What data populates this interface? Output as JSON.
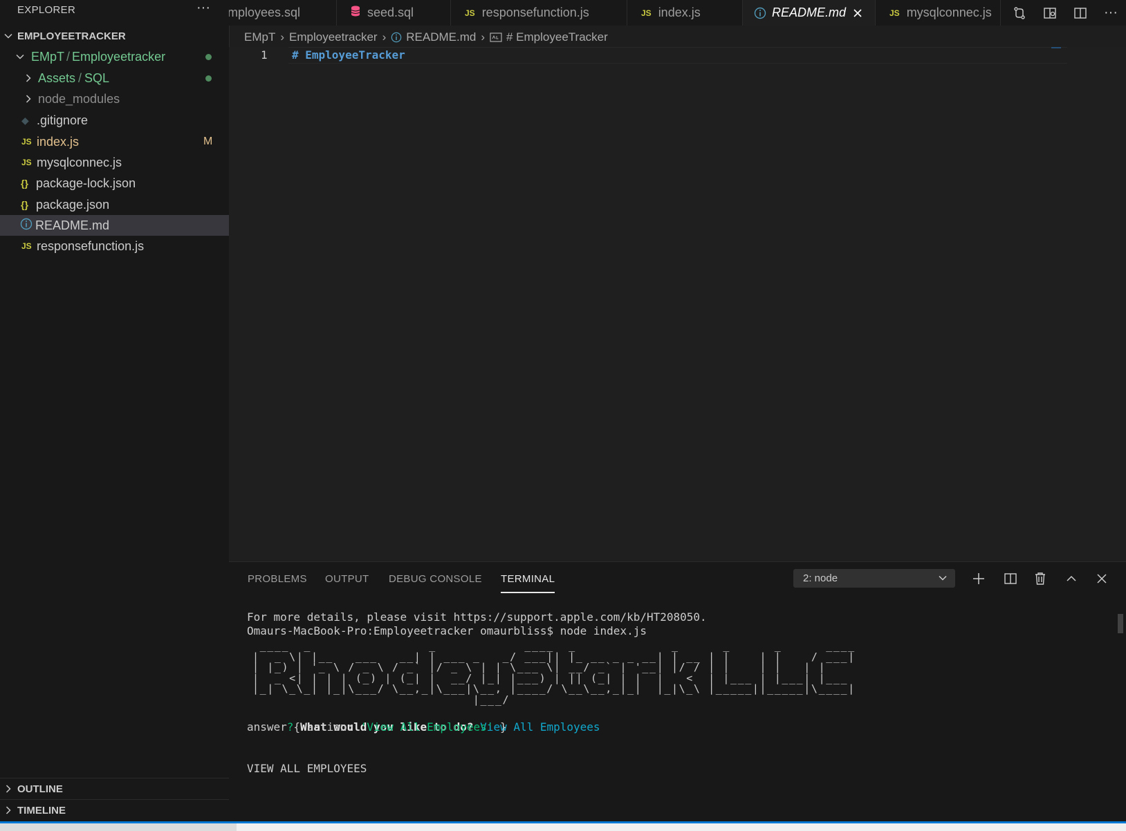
{
  "explorer": {
    "title": "EXPLORER",
    "more": "···",
    "workspace": "EMPLOYEETRACKER",
    "folder": {
      "prefix": "EMpT",
      "sep": "/",
      "name": "Employeetracker"
    },
    "items": [
      {
        "label": "Assets",
        "sub": "SQL",
        "type": "folder"
      },
      {
        "label": "node_modules",
        "type": "folder"
      },
      {
        "label": ".gitignore",
        "type": "git"
      },
      {
        "label": "index.js",
        "type": "js",
        "badge": "M"
      },
      {
        "label": "mysqlconnec.js",
        "type": "js"
      },
      {
        "label": "package-lock.json",
        "type": "json"
      },
      {
        "label": "package.json",
        "type": "json"
      },
      {
        "label": "README.md",
        "type": "info"
      },
      {
        "label": "responsefunction.js",
        "type": "js"
      }
    ],
    "sections": {
      "outline": "OUTLINE",
      "timeline": "TIMELINE"
    }
  },
  "tabs": [
    {
      "label": "employees.sql"
    },
    {
      "label": "seed.sql"
    },
    {
      "label": "responsefunction.js",
      "icon": "JS"
    },
    {
      "label": "index.js",
      "icon": "JS"
    },
    {
      "label": "README.md",
      "active": true
    },
    {
      "label": "mysqlconnec.js",
      "icon": "JS"
    }
  ],
  "breadcrumb": {
    "root": "EMpT",
    "folder": "Employeetracker",
    "file": "README.md",
    "symbol": "# EmployeeTracker"
  },
  "editor": {
    "line_number": "1",
    "line_text": "# EmployeeTracker"
  },
  "panel": {
    "tabs": [
      "PROBLEMS",
      "OUTPUT",
      "DEBUG CONSOLE",
      "TERMINAL"
    ],
    "active_tab": "TERMINAL",
    "terminal_select": "2: node"
  },
  "terminal": {
    "line1": "For more details, please visit https://support.apple.com/kb/HT208050.",
    "line2": "Omaurs-MacBook-Pro:Employeetracker omaurbliss$ node index.js",
    "ascii_art": " ____  _                _            ____  _             _      _      _      ____ \n|  _ \\| |__   ___   __| | ___ _   _/ ___|| |_ __ _ _ __| | __ | |    | |    / ___|\n| |_) | '_ \\ / _ \\ / _` |/ _ \\ | | \\___ \\| __/ _` | '__| |/ / | |    | |   | |    \n|  _ <| | | | (_) | (_| |  __/ |_| |___) | || (_| | |  |   <  | |___ | |___| |___ \n|_| \\_\\_| |_|\\___/ \\__,_|\\___|\\__, |____/ \\__\\__,_|_|  |_|\\_\\ |_____||_____|\\____|\n                              |___/                                                 ",
    "prompt_mark": "?",
    "prompt_question": "What would you like to do?",
    "prompt_answer": "View All Employees",
    "answer_prefix": "answer { action: ",
    "answer_value": "'View All Employees'",
    "answer_suffix": " }",
    "output_heading": "VIEW ALL EMPLOYEES"
  },
  "colors": {
    "accent": "#0078d4",
    "git_added": "#73c991",
    "git_modified": "#e2c08d",
    "js_icon": "#cbcb41",
    "sql_icon": "#f55385"
  }
}
